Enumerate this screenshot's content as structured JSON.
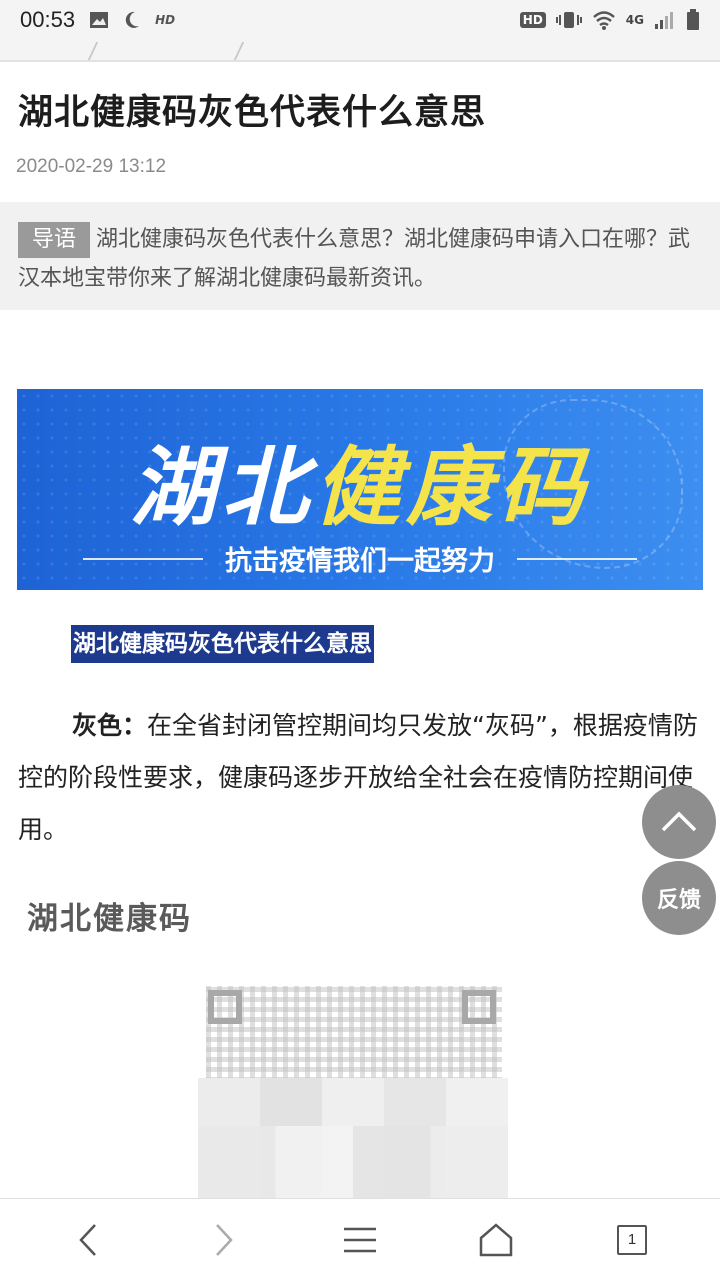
{
  "status_bar": {
    "time": "00:53",
    "hd_label": "HD",
    "net_badge": "HD",
    "network_type": "4G",
    "icons": [
      "image-icon",
      "moon-icon",
      "vibrate-icon",
      "wifi-icon",
      "signal-icon",
      "battery-icon"
    ]
  },
  "article": {
    "title": "湖北健康码灰色代表什么意思",
    "date": "2020-02-29 13:12",
    "lead_tag": "导语",
    "lead_text": "湖北健康码灰色代表什么意思？湖北健康码申请入口在哪？武汉本地宝带你来了解湖北健康码最新资讯。",
    "banner": {
      "headline_white": "湖北",
      "headline_yellow": "健康码",
      "slogan": "抗击疫情我们一起努力"
    },
    "subheading": "湖北健康码灰色代表什么意思",
    "paragraph_strong": "灰色：",
    "paragraph_text": "在全省封闭管控期间均只发放“灰码”，根据疫情防控的阶段性要求，健康码逐步开放给全社会在疫情防控期间使用。",
    "qr_card_title": "湖北健康码"
  },
  "floating": {
    "feedback_label": "反馈"
  },
  "bottom_nav": {
    "tab_count": "1",
    "icons": [
      "back-icon",
      "forward-icon",
      "menu-icon",
      "home-icon",
      "tabs-icon"
    ]
  },
  "colors": {
    "banner_blue": "#2a7ae8",
    "banner_yellow": "#f5e34c",
    "highlight_navy": "#1e3a8f",
    "fab_gray": "#8e8e8e"
  }
}
